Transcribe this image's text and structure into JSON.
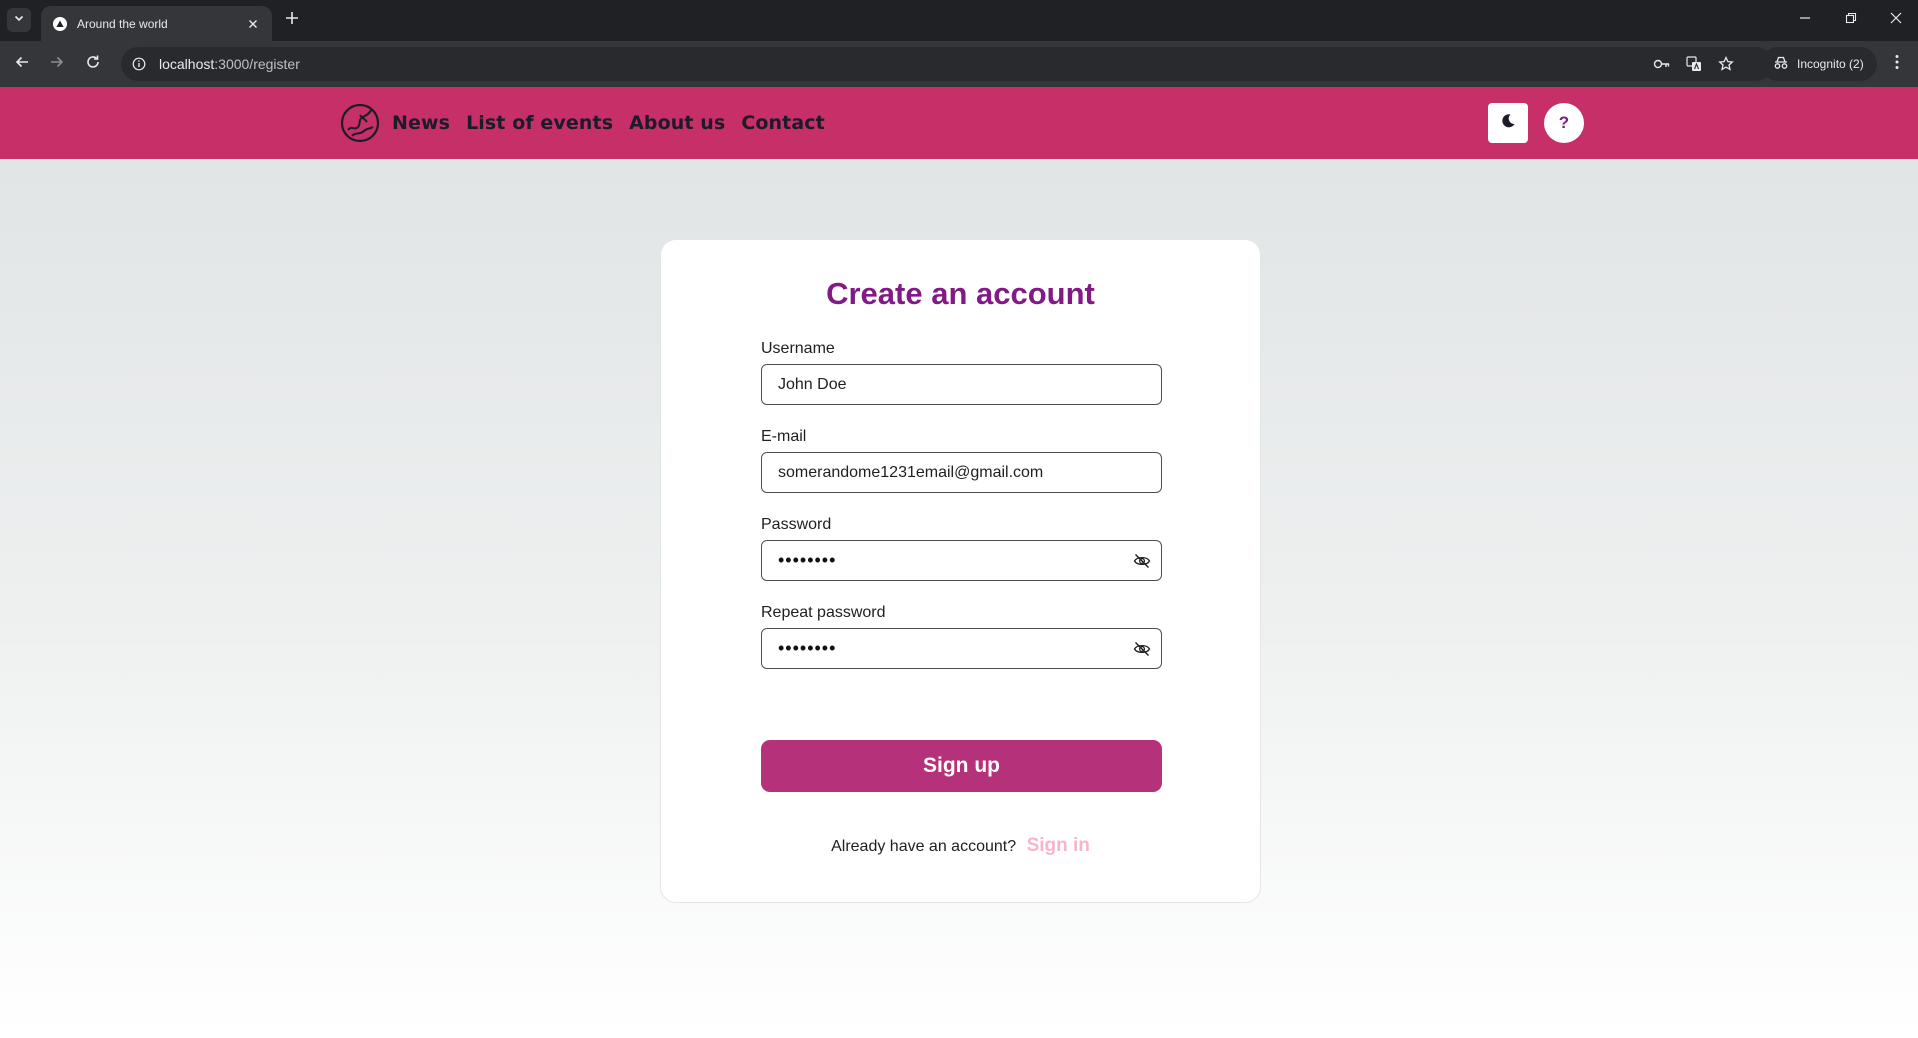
{
  "browser": {
    "tab_title": "Around the world",
    "url_host": "localhost",
    "url_path": ":3000/register",
    "incognito_label": "Incognito (2)"
  },
  "header": {
    "nav": [
      "News",
      "List of events",
      "About us",
      "Contact"
    ],
    "help_label": "?",
    "accent_color": "#c62f67"
  },
  "form": {
    "title": "Create an account",
    "username_label": "Username",
    "username_value": "John Doe",
    "email_label": "E-mail",
    "email_value": "somerandome1231email@gmail.com",
    "password_label": "Password",
    "password_mask": "••••••••",
    "repeat_label": "Repeat password",
    "repeat_mask": "••••••••",
    "submit_label": "Sign up",
    "have_account_text": "Already have an account?",
    "signin_label": "Sign in"
  }
}
